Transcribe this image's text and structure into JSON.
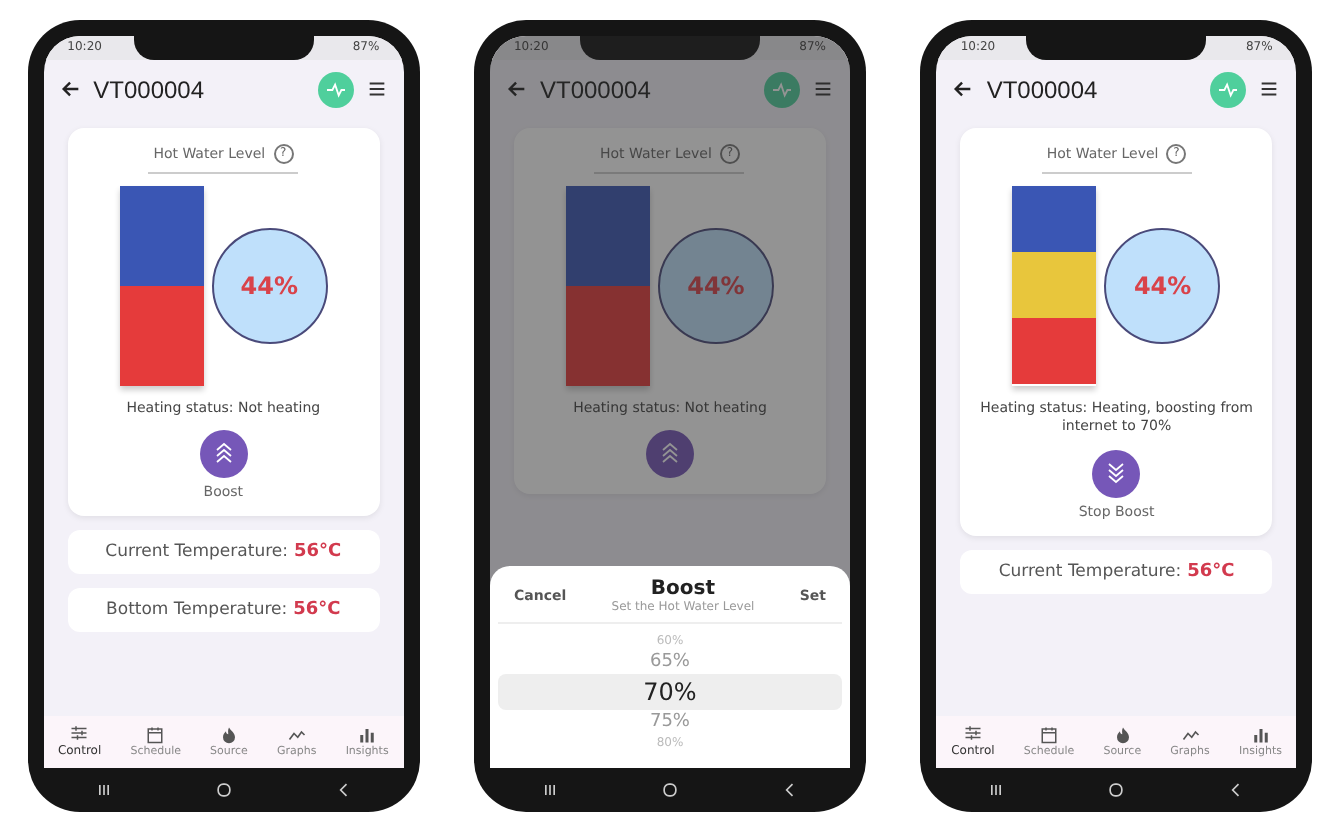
{
  "phones": [
    {
      "time": "10:20",
      "battery": "87%",
      "title": "VT000004",
      "dimmed": false,
      "card": {
        "label": "Hot Water Level",
        "help": "?",
        "layers": [
          {
            "color": "#3a56b4"
          },
          {
            "color": "#e53b3b"
          }
        ],
        "percent": "44%",
        "status": "Heating status: Not heating",
        "boost": {
          "kind": "up",
          "label": "Boost"
        }
      },
      "readings": [
        {
          "label": "Current Temperature:",
          "value": "56°C"
        },
        {
          "label": "Bottom Temperature:",
          "value": "56°C"
        }
      ],
      "nav": [
        {
          "kind": "sliders",
          "label": "Control",
          "selected": true
        },
        {
          "kind": "calendar",
          "label": "Schedule",
          "selected": false
        },
        {
          "kind": "flame",
          "label": "Source",
          "selected": false
        },
        {
          "kind": "trend",
          "label": "Graphs",
          "selected": false
        },
        {
          "kind": "bars",
          "label": "Insights",
          "selected": false
        }
      ]
    },
    {
      "time": "10:20",
      "battery": "87%",
      "title": "VT000004",
      "dimmed": true,
      "card": {
        "label": "Hot Water Level",
        "help": "?",
        "layers": [
          {
            "color": "#313f6e"
          },
          {
            "color": "#863131"
          }
        ],
        "percent": "44%",
        "status": "Heating status: Not heating",
        "boost": {
          "kind": "up"
        }
      },
      "sheet": {
        "cancel": "Cancel",
        "title": "Boost",
        "subtitle": "Set the Hot Water Level",
        "confirm": "Set",
        "options": [
          {
            "label": "60%",
            "selected": false
          },
          {
            "label": "65%",
            "selected": false
          },
          {
            "label": "70%",
            "selected": true
          },
          {
            "label": "75%",
            "selected": false
          },
          {
            "label": "80%",
            "selected": false
          }
        ]
      }
    },
    {
      "time": "10:20",
      "battery": "87%",
      "title": "VT000004",
      "dimmed": false,
      "card": {
        "label": "Hot Water Level",
        "help": "?",
        "layers": [
          {
            "color": "#3a56b4"
          },
          {
            "color": "#e8c63c"
          },
          {
            "color": "#e53b3b"
          }
        ],
        "percent": "44%",
        "status": "Heating status: Heating, boosting from internet to 70%",
        "boost": {
          "kind": "down",
          "label": "Stop Boost"
        }
      },
      "readings": [
        {
          "label": "Current Temperature:",
          "value": "56°C"
        }
      ],
      "nav": [
        {
          "kind": "sliders",
          "label": "Control",
          "selected": true
        },
        {
          "kind": "calendar",
          "label": "Schedule",
          "selected": false
        },
        {
          "kind": "flame",
          "label": "Source",
          "selected": false
        },
        {
          "kind": "trend",
          "label": "Graphs",
          "selected": false
        },
        {
          "kind": "bars",
          "label": "Insights",
          "selected": false
        }
      ]
    }
  ]
}
